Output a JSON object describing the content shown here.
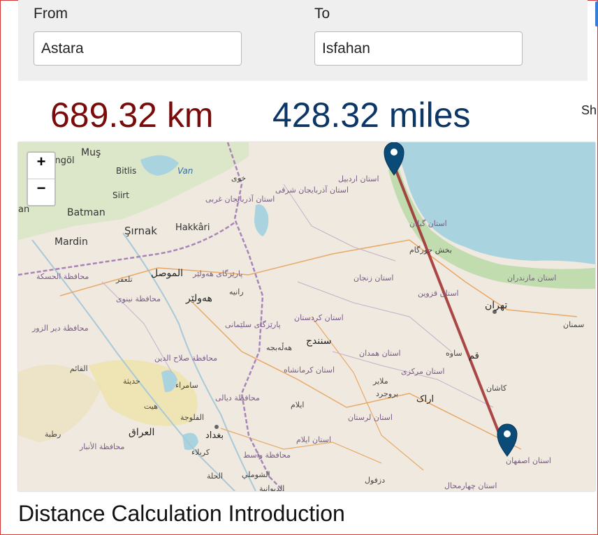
{
  "form": {
    "from_label": "From",
    "from_value": "Astara",
    "to_label": "To",
    "to_value": "Isfahan"
  },
  "result": {
    "km": "689.32 km",
    "miles": "428.32 miles",
    "share_partial": "Sh"
  },
  "colors": {
    "km": "#7a0b0b",
    "miles": "#0b3666",
    "route": "#9e2a2a",
    "marker": "#0a4b78",
    "sea": "#a9d3df"
  },
  "map": {
    "zoom_in": "+",
    "zoom_out": "−",
    "labels": {
      "mus": "Muş",
      "bingol": "Bingöl",
      "bitlis": "Bitlis",
      "van": "Van",
      "siirt": "Siirt",
      "batman": "Batman",
      "sirnak": "Şırnak",
      "hakkari": "Hakkâri",
      "mardin": "Mardin",
      "an": "an",
      "khoy": "خوی",
      "azar_west": "استان آذربایجان غربی",
      "azar_east": "استان آذربایجان شرقی",
      "ardabil": "استان اردبیل",
      "gilan": "استان گیلان",
      "bakhsh": "بخش جورگام",
      "mosul": "الموصل",
      "hewler_prov": "پارێزگای هەولێر",
      "rania": "رانیە",
      "hasakah": "محافظة الحسكة",
      "tal_afar": "تلعفر",
      "nineveh": "محافظة نينوى",
      "hewler": "هەولێر",
      "zanjan": "استان زنجان",
      "qazvin": "استان قزوین",
      "tehran": "تهران",
      "mazandaran": "استان مازندران",
      "semnan": "سمنان",
      "deir": "محافظة دير الزور",
      "kurdistan": "استان کردستان",
      "sulaymani": "پارێزگای سلێمانی",
      "halabja": "هەڵەبجە",
      "sanandaj": "سنندج",
      "salah": "محافظة صلاح الدين",
      "qaim": "القائم",
      "haditha": "حديثة",
      "samarra": "سامراء",
      "hamadan": "استان همدان",
      "saveh": "ساوه",
      "qom": "قم",
      "kermanshah": "استان کرمانشاه",
      "markazi": "استان مرکزی",
      "malayer": "ملایر",
      "borujerd": "بروجرد",
      "arak": "اراک",
      "kashan": "کاشان",
      "hit": "هيت",
      "diyala": "محافظة ديالى",
      "ilam_city": "ایلام",
      "ilam": "استان ایلام",
      "lorestan": "استان لرستان",
      "iraq": "العراق",
      "rutba": "رطبة",
      "fallujah": "الفلوجة",
      "baghdad": "بغداد",
      "anbar": "محافظة الأنبار",
      "karbala": "كربلاء",
      "wasit": "محافظة واسط",
      "hillah": "الحلة",
      "shumali": "الشوملي",
      "diwaniyah": "الديوانية",
      "dezful": "دزفول",
      "isfahan": "استان اصفهان",
      "chaharmahal": "استان چهارمحال"
    }
  },
  "content": {
    "heading": "Distance Calculation Introduction"
  }
}
